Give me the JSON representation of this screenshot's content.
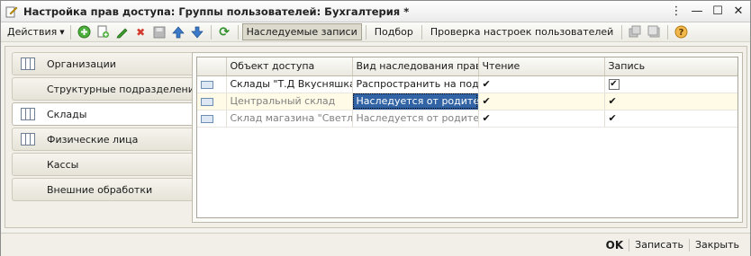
{
  "window": {
    "title": "Настройка прав доступа: Группы пользователей: Бухгалтерия *",
    "controls": {
      "menu": "⋮",
      "minimize": "—",
      "maximize": "☐",
      "close": "✕"
    }
  },
  "toolbar": {
    "actions_label": "Действия",
    "inherited_records_label": "Наследуемые записи",
    "selection_label": "Подбор",
    "check_settings_label": "Проверка настроек пользователей"
  },
  "tabs": [
    {
      "label": "Организации",
      "icon": "table-icon"
    },
    {
      "label": "Структурные подразделения",
      "icon": ""
    },
    {
      "label": "Склады",
      "icon": "table-icon"
    },
    {
      "label": "Физические лица",
      "icon": "table-icon"
    },
    {
      "label": "Кассы",
      "icon": ""
    },
    {
      "label": "Внешние обработки",
      "icon": ""
    }
  ],
  "active_tab": "Склады",
  "table": {
    "columns": [
      "",
      "Объект доступа",
      "Вид наследования прав...",
      "Чтение",
      "Запись"
    ],
    "rows": [
      {
        "object": "Склады \"Т.Д Вкусняшка\"",
        "inheritance": "Распространить на под...",
        "read": "✔",
        "write": "✔"
      },
      {
        "object": "Центральный склад",
        "inheritance": "Наследуется от родителя",
        "read": "✔",
        "write": "✔"
      },
      {
        "object": "Склад магазина \"Светл...",
        "inheritance": "Наследуется от родителя",
        "read": "✔",
        "write": "✔"
      }
    ]
  },
  "footer": {
    "ok_label": "OK",
    "save_label": "Записать",
    "close_label": "Закрыть"
  },
  "colors": {
    "selection": "#3264a5",
    "accent_green": "#3a9a2c",
    "accent_red": "#d23a2c",
    "accent_blue": "#2d6cc0"
  }
}
